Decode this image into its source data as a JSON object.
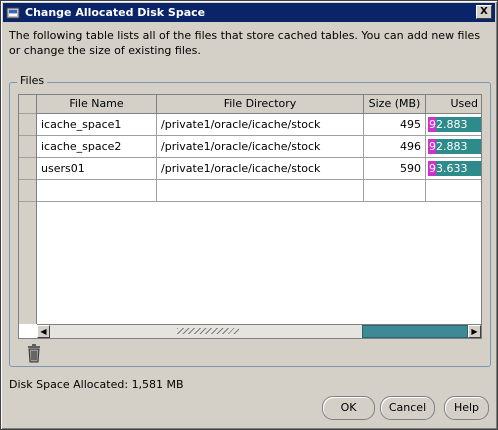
{
  "window": {
    "title": "Change Allocated Disk Space",
    "close_glyph": "X"
  },
  "intro_text": "The following table lists all of the files that store cached tables.  You can add new files or change the size of existing files.",
  "group": {
    "label": "Files"
  },
  "table": {
    "columns": [
      "File Name",
      "File Directory",
      "Size (MB)",
      "Used"
    ],
    "rows": [
      {
        "file_name": "icache_space1",
        "directory": "/private1/oracle/icache/stock",
        "size": "495",
        "used": "92.883",
        "used_pct": 92.883
      },
      {
        "file_name": "icache_space2",
        "directory": "/private1/oracle/icache/stock",
        "size": "496",
        "used": "92.883",
        "used_pct": 92.883
      },
      {
        "file_name": "users01",
        "directory": "/private1/oracle/icache/stock",
        "size": "590",
        "used": "93.633",
        "used_pct": 93.633
      }
    ]
  },
  "icons": {
    "trash": "trash-icon",
    "app": "disk-icon"
  },
  "colors": {
    "used_fill": "#cc33cc",
    "used_bg": "#2e8b8b",
    "title_bg": "#0a246a"
  },
  "footer": {
    "disk_space_label": "Disk Space Allocated:  1,581 MB"
  },
  "buttons": {
    "ok": "OK",
    "cancel": "Cancel",
    "help": "Help"
  }
}
